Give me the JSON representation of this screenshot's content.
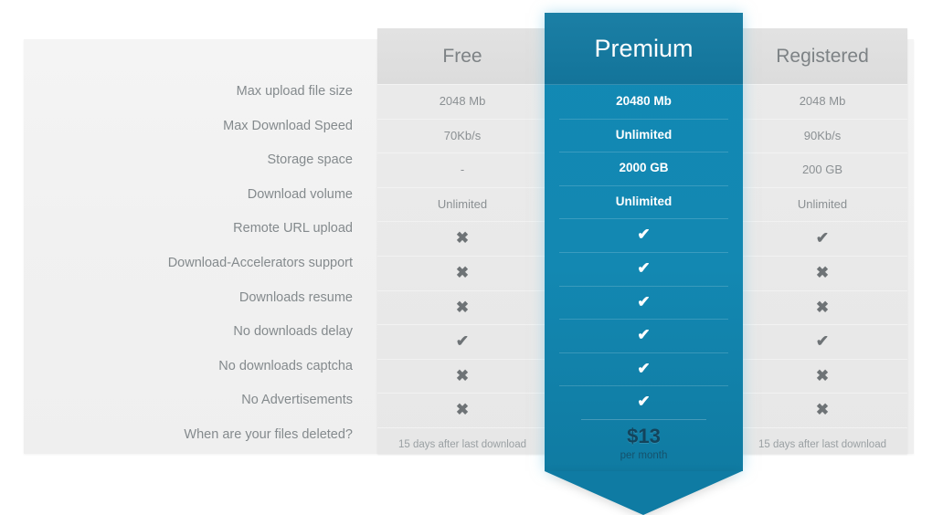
{
  "table": {
    "feature_labels": [
      "Max upload file size",
      "Max Download Speed",
      "Storage space",
      "Download volume",
      "Remote URL upload",
      "Download-Accelerators support",
      "Downloads resume",
      "No downloads delay",
      "No downloads captcha",
      "No Advertisements",
      "When are your files deleted?"
    ],
    "columns": [
      {
        "name": "free",
        "header": "Free",
        "values": [
          "2048 Mb",
          "70Kb/s",
          "-",
          "Unlimited",
          "cross",
          "cross",
          "cross",
          "check",
          "cross",
          "cross"
        ],
        "footer": "15 days after last download"
      },
      {
        "name": "premium",
        "header": "Premium",
        "values": [
          "20480 Mb",
          "Unlimited",
          "2000 GB",
          "Unlimited",
          "check",
          "check",
          "check",
          "check",
          "check",
          "check"
        ],
        "price_amount": "$13",
        "price_period": "per month"
      },
      {
        "name": "registered",
        "header": "Registered",
        "values": [
          "2048 Mb",
          "90Kb/s",
          "200 GB",
          "Unlimited",
          "check",
          "cross",
          "cross",
          "check",
          "cross",
          "cross"
        ],
        "footer": "15 days after last download"
      }
    ]
  },
  "glyphs": {
    "check": "✔",
    "cross": "✖"
  },
  "colors": {
    "premium_accent": "#1289b4",
    "premium_header": "#13749a",
    "panel_background": "#f1f1f1",
    "column_background": "#e9e9e9",
    "label_text": "#848a8d",
    "price_text": "#13445c"
  }
}
